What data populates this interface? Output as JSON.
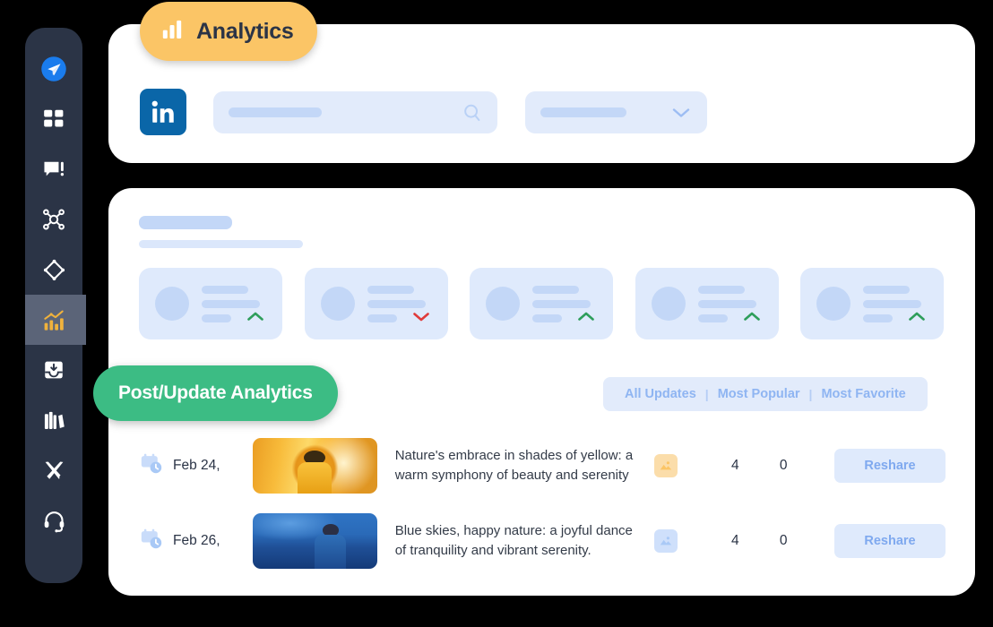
{
  "sidebar": {
    "items": [
      {
        "icon": "paper-plane-icon",
        "name": "sidebar-item-send",
        "active": false
      },
      {
        "icon": "grid-dashboard-icon",
        "name": "sidebar-item-dashboard",
        "active": false
      },
      {
        "icon": "chat-alert-icon",
        "name": "sidebar-item-messages",
        "active": false
      },
      {
        "icon": "network-nodes-icon",
        "name": "sidebar-item-network",
        "active": false
      },
      {
        "icon": "diamond-target-icon",
        "name": "sidebar-item-engage",
        "active": false
      },
      {
        "icon": "bar-chart-trend-icon",
        "name": "sidebar-item-analytics",
        "active": true
      },
      {
        "icon": "inbox-download-icon",
        "name": "sidebar-item-inbox",
        "active": false
      },
      {
        "icon": "library-books-icon",
        "name": "sidebar-item-library",
        "active": false
      },
      {
        "icon": "tools-wrench-icon",
        "name": "sidebar-item-tools",
        "active": false
      },
      {
        "icon": "headset-support-icon",
        "name": "sidebar-item-support",
        "active": false
      }
    ]
  },
  "analytics_pill": {
    "label": "Analytics",
    "icon": "bar-chart-icon",
    "color": "#fbc566"
  },
  "top_panel": {
    "network_logo": "linkedin-icon",
    "search": {
      "placeholder": "",
      "value": "",
      "icon": "search-icon"
    },
    "select": {
      "value": "",
      "icon": "chevron-down-icon"
    }
  },
  "main_panel": {
    "stat_cards": [
      {
        "trend": "up",
        "trend_color": "#2e9e5b"
      },
      {
        "trend": "down",
        "trend_color": "#e03b3b"
      },
      {
        "trend": "up",
        "trend_color": "#2e9e5b"
      },
      {
        "trend": "up",
        "trend_color": "#2e9e5b"
      },
      {
        "trend": "up",
        "trend_color": "#2e9e5b"
      }
    ]
  },
  "post_pill": {
    "label": "Post/Update Analytics",
    "color": "#3cbc84"
  },
  "filters": {
    "tabs": [
      "All Updates",
      "Most Popular",
      "Most Favorite"
    ],
    "separator": "|"
  },
  "table": {
    "rows": [
      {
        "date": "Feb 24,",
        "date_icon": "calendar-clock-icon",
        "thumb_style": "autumn",
        "thumb_alt": "person in yellow coat among autumn leaves",
        "text": "Nature's embrace in shades of yellow: a warm symphony of beauty and serenity",
        "type_icon": "image-icon",
        "type_tone": "warm",
        "metric_1": "4",
        "metric_2": "0",
        "action": "Reshare"
      },
      {
        "date": "Feb 26,",
        "date_icon": "calendar-clock-icon",
        "thumb_style": "blue",
        "thumb_alt": "woman against deep blue sky",
        "text": "Blue skies, happy nature: a joyful dance of tranquility and vibrant serenity.",
        "type_icon": "image-icon",
        "type_tone": "cool",
        "metric_1": "4",
        "metric_2": "0",
        "action": "Reshare"
      }
    ]
  }
}
